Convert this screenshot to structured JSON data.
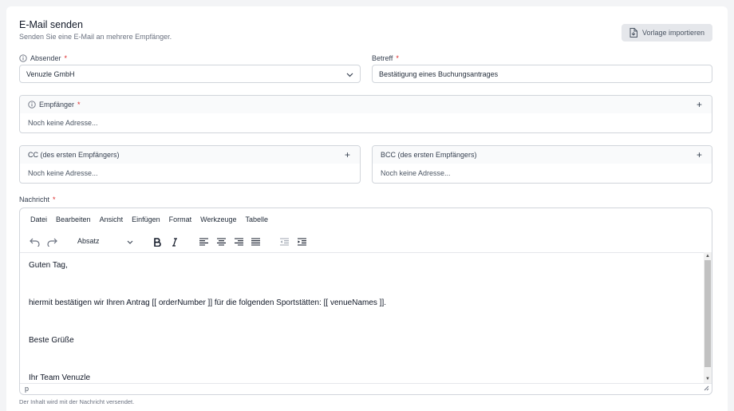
{
  "header": {
    "title": "E-Mail senden",
    "subtitle": "Senden Sie eine E-Mail an mehrere Empfänger.",
    "import_button": "Vorlage importieren"
  },
  "sender": {
    "label": "Absender",
    "required_mark": "*",
    "value": "Venuzle GmbH"
  },
  "subject": {
    "label": "Betreff",
    "required_mark": "*",
    "value": "Bestätigung eines Buchungsantrages"
  },
  "recipients": {
    "label": "Empfänger",
    "required_mark": "*",
    "add": "+",
    "empty": "Noch keine Adresse..."
  },
  "cc": {
    "label": "CC (des ersten Empfängers)",
    "add": "+",
    "empty": "Noch keine Adresse..."
  },
  "bcc": {
    "label": "BCC (des ersten Empfängers)",
    "add": "+",
    "empty": "Noch keine Adresse..."
  },
  "message": {
    "label": "Nachricht",
    "required_mark": "*",
    "menu": [
      "Datei",
      "Bearbeiten",
      "Ansicht",
      "Einfügen",
      "Format",
      "Werkzeuge",
      "Tabelle"
    ],
    "block_format": "Absatz",
    "lines": [
      "Guten Tag,",
      "",
      "hiermit bestätigen wir Ihren Antrag [[ orderNumber ]] für die folgenden Sportstätten: [[ venueNames ]].",
      "",
      "Beste Grüße",
      "",
      "Ihr Team Venuzle"
    ],
    "status_path": "p",
    "scroll_up": "▲",
    "scroll_down": "▼",
    "hint": "Der Inhalt wird mit der Nachricht versendet."
  },
  "icons": [
    "info-icon",
    "file-import-icon",
    "chevron-down-icon",
    "undo-icon",
    "redo-icon",
    "bold-icon",
    "italic-icon",
    "align-left-icon",
    "align-center-icon",
    "align-right-icon",
    "align-justify-icon",
    "outdent-icon",
    "indent-icon",
    "resize-handle-icon"
  ]
}
